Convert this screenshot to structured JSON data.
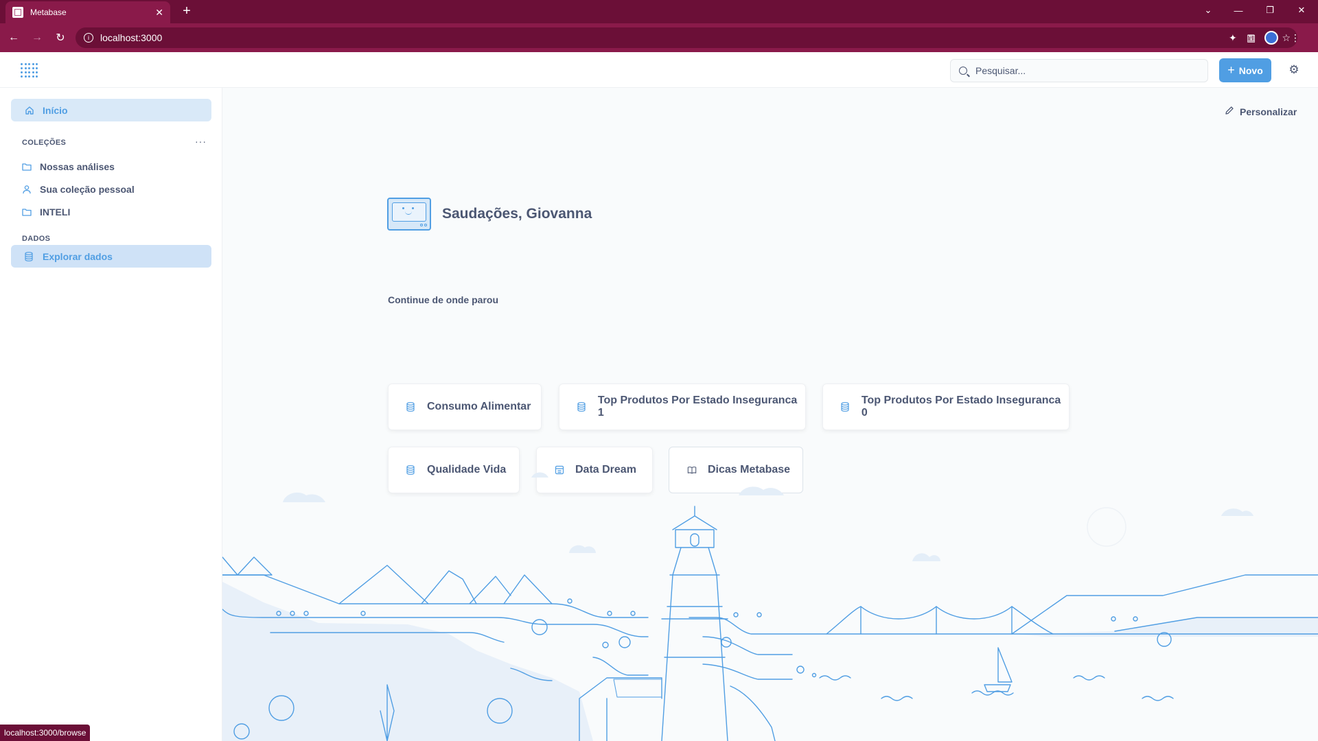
{
  "browser": {
    "tab_title": "Metabase",
    "url": "localhost:3000",
    "status_url": "localhost:3000/browse"
  },
  "header": {
    "search_placeholder": "Pesquisar...",
    "new_label": "Novo"
  },
  "sidebar": {
    "home": "Início",
    "collections_title": "COLEÇÕES",
    "collections": [
      {
        "label": "Nossas análises",
        "icon": "folder-icon"
      },
      {
        "label": "Sua coleção pessoal",
        "icon": "person-icon"
      },
      {
        "label": "INTELI",
        "icon": "folder-icon"
      }
    ],
    "data_title": "DADOS",
    "browse_data": "Explorar dados"
  },
  "main": {
    "customize": "Personalizar",
    "greeting": "Saudações, Giovanna",
    "recents_title": "Continue de onde parou",
    "recents": [
      {
        "label": "Consumo Alimentar",
        "icon": "database-icon"
      },
      {
        "label": "Top Produtos Por Estado Inseguranca 1",
        "icon": "database-icon"
      },
      {
        "label": "Top Produtos Por Estado Inseguranca 0",
        "icon": "database-icon"
      },
      {
        "label": "Qualidade Vida",
        "icon": "database-icon"
      },
      {
        "label": "Data Dream",
        "icon": "table-icon"
      },
      {
        "label": "Dicas Metabase",
        "icon": "book-icon"
      }
    ]
  },
  "colors": {
    "brand": "#509ee3",
    "browser_dark": "#6b0f37",
    "browser_mid": "#8a1a4a"
  }
}
